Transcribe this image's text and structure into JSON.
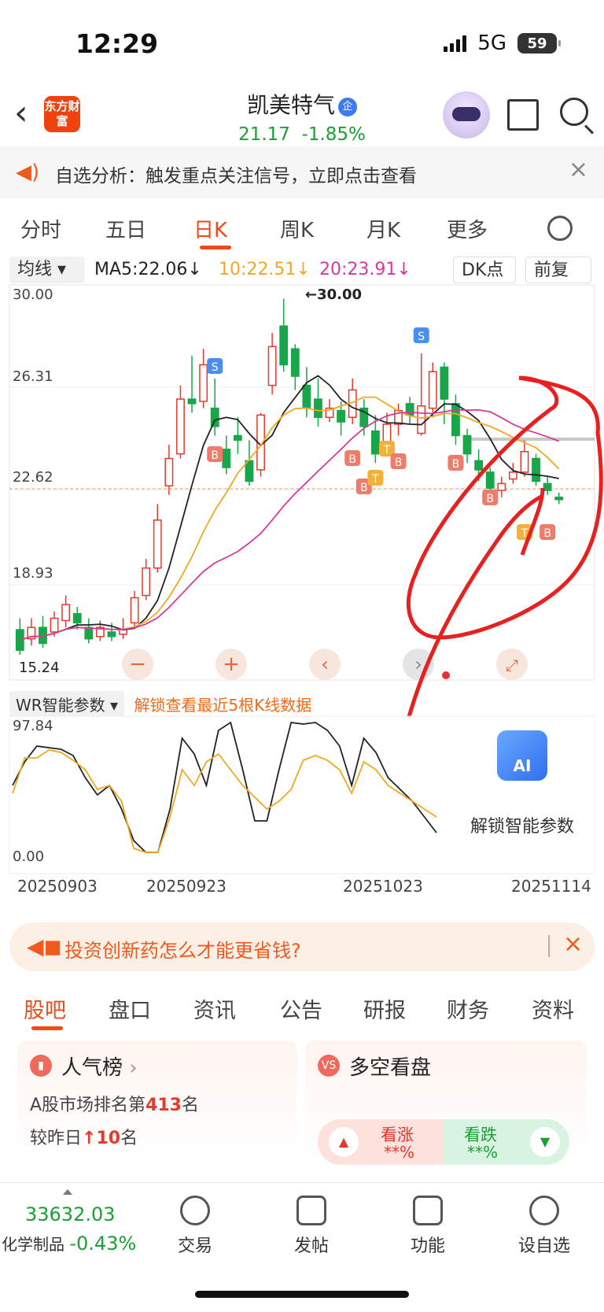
{
  "status": {
    "time": "12:29",
    "network": "5G",
    "battery": "59"
  },
  "header": {
    "logo": "东方财富",
    "name": "凯美特气",
    "name_badge": "企",
    "price": "21.17",
    "change": "-1.85%"
  },
  "notice": {
    "text": "自选分析：触发重点关注信号，立即点击查看",
    "close": "×"
  },
  "tabs": [
    "分时",
    "五日",
    "日K",
    "周K",
    "月K",
    "更多"
  ],
  "ma": {
    "type": "均线",
    "ma5": "MA5:22.06",
    "ma10": "10:22.51",
    "ma20": "20:23.91",
    "dk": "DK点",
    "fq": "前复权"
  },
  "chart_data": [
    {
      "type": "candlestick",
      "series": [
        {
          "name": "MA5",
          "value": 22.06
        },
        {
          "name": "MA10",
          "value": 22.51
        },
        {
          "name": "MA20",
          "value": 23.91
        }
      ],
      "y_ticks": [
        "30.00",
        "26.31",
        "22.62",
        "18.93",
        "15.24"
      ],
      "annotations": [
        "←30.00",
        "15.24"
      ],
      "signals": [
        "S",
        "B",
        "T"
      ]
    },
    {
      "type": "line",
      "name": "WR",
      "y_ticks": [
        "97.84",
        "0.00"
      ],
      "x_ticks": [
        "20250903",
        "20250923",
        "20251023",
        "20251114"
      ]
    }
  ],
  "wr": {
    "label": "WR智能参数",
    "lock_text": "解锁查看最近5根K线数据",
    "ai_label": "解锁智能参数",
    "ai_icon": "AI"
  },
  "promo": {
    "text": "投资创新药怎么才能更省钱?",
    "close": "×"
  },
  "subtabs": [
    "股吧",
    "盘口",
    "资讯",
    "公告",
    "研报",
    "财务",
    "资料"
  ],
  "popularity": {
    "title": "人气榜",
    "rank_prefix": "A股市场排名第",
    "rank": "413",
    "rank_suffix": "名",
    "change_prefix": "较昨日",
    "change": "10",
    "change_suffix": "名"
  },
  "longshort": {
    "title": "多空看盘",
    "up_label": "看涨",
    "up_value": "**%",
    "down_label": "看跌",
    "down_value": "**%"
  },
  "bottom": {
    "index_value": "33632.03",
    "index_name": "化学制品",
    "index_change": "-0.43%",
    "items": [
      "交易",
      "发帖",
      "功能",
      "设自选"
    ]
  }
}
